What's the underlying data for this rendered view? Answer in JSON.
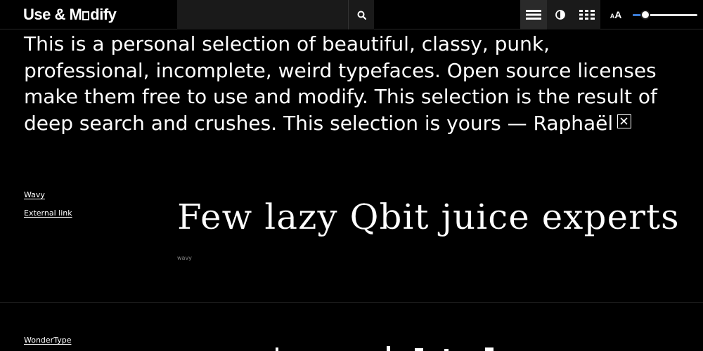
{
  "header": {
    "logo_text_before": "Use & M",
    "logo_text_after": "dify",
    "logo_o_glyph": "square-o-icon",
    "search": {
      "value": "",
      "placeholder": ""
    },
    "icons": [
      "search-icon",
      "list-view-icon",
      "contrast-icon",
      "grid-view-icon",
      "font-size-icon"
    ],
    "font_size_glyph_small": "A",
    "font_size_glyph_big": "A",
    "size_slider": {
      "fraction": 0.2
    },
    "colors": {
      "active_tool": "#2a2a2a",
      "slider_accent": "#3a7bd5"
    }
  },
  "intro": {
    "text": "This is a personal selection of beautiful, classy, punk, professional, incomplete, weird typefaces. Open source licenses make them free to use and modify. This selection is the result of deep search and crushes. This selection is yours — Raphaël",
    "close_icon": "close-x-icon"
  },
  "fonts": [
    {
      "name": "Wavy",
      "link_label": "External link",
      "specimen": "Few lazy Qbit juice experts",
      "label": "wavy"
    },
    {
      "name": "WonderType",
      "link_label": "",
      "specimen": "",
      "label": ""
    }
  ]
}
